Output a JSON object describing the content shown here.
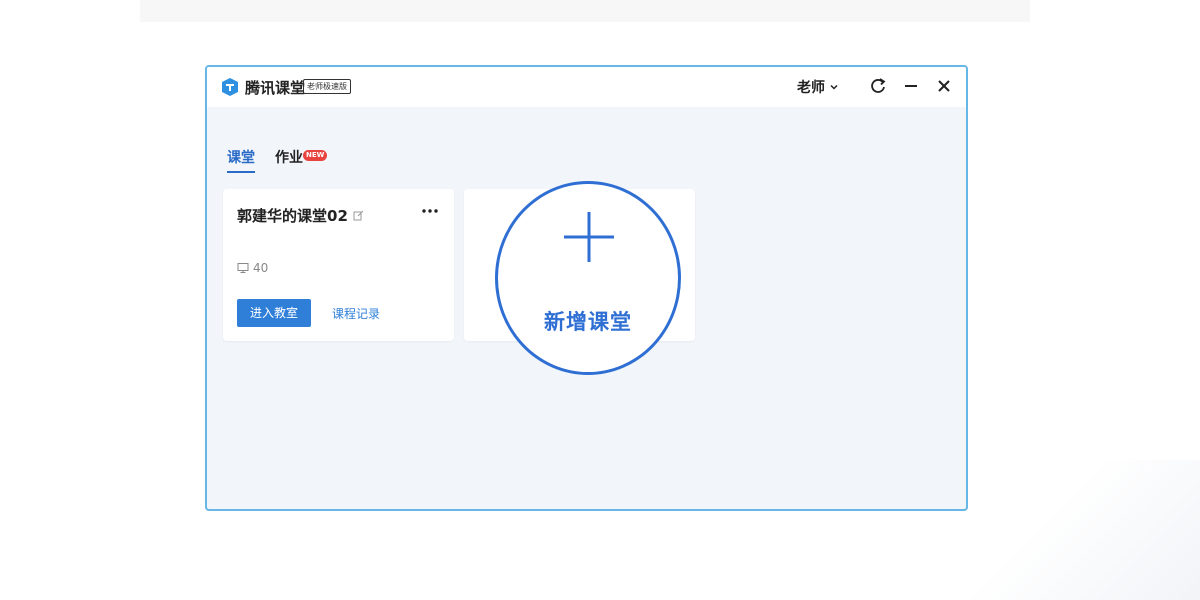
{
  "app": {
    "name": "腾讯课堂",
    "edition_badge": "老师极速版",
    "logo_icon": "tencent-classroom-logo-icon"
  },
  "header": {
    "user_role": "老师",
    "user_menu_icon": "chevron-down-icon",
    "refresh_icon": "refresh-icon",
    "minimize_icon": "minimize-icon",
    "close_icon": "close-icon"
  },
  "tabs": [
    {
      "label": "课堂",
      "active": true
    },
    {
      "label": "作业",
      "badge": "NEW",
      "active": false
    }
  ],
  "courses": [
    {
      "title": "郭建华的课堂02",
      "edit_icon": "edit-icon",
      "more_icon": "more-horizontal-icon",
      "count_icon": "screen-icon",
      "count": "40",
      "enter_label": "进入教室",
      "records_label": "课程记录"
    }
  ],
  "add_course": {
    "label": "新增课堂",
    "icon": "plus-icon"
  },
  "colors": {
    "accent": "#2f7fd9",
    "highlight_ring": "#2f6fd4",
    "window_border": "#66b6e6",
    "window_bg": "#f2f6fa",
    "new_badge": "#e8433e"
  }
}
